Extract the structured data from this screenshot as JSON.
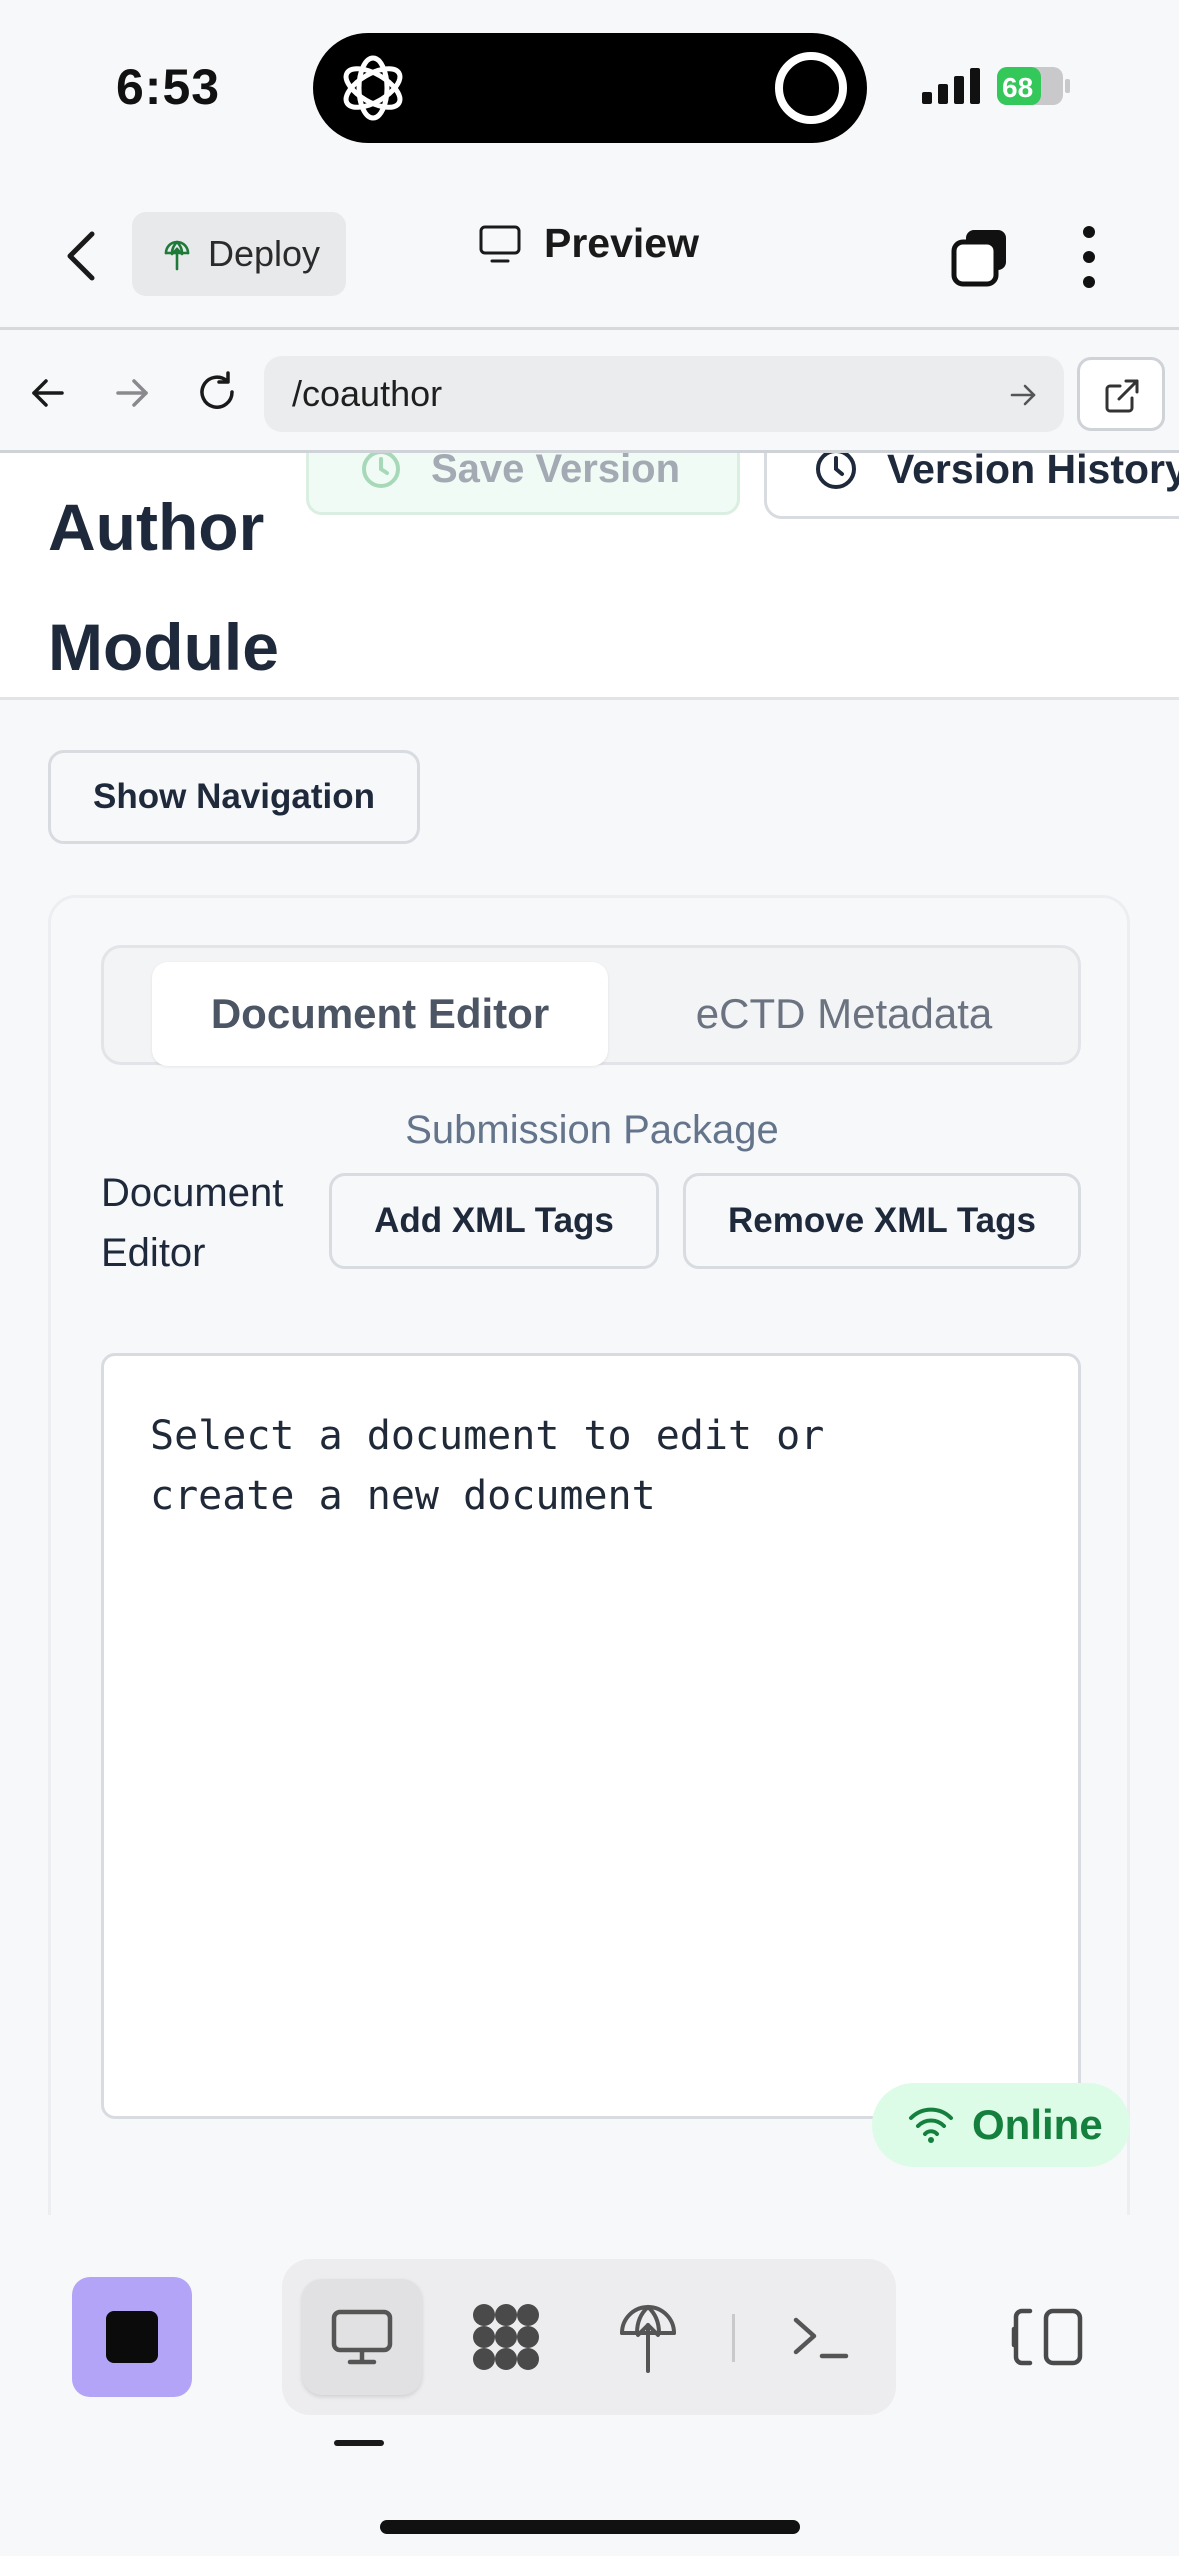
{
  "status_bar": {
    "time": "6:53",
    "battery": "68"
  },
  "app_bar": {
    "deploy_label": "Deploy",
    "preview_label": "Preview"
  },
  "browser": {
    "url": "/coauthor"
  },
  "page_header": {
    "title": "Author Module",
    "save_version_label": "Save Version",
    "version_history_label": "Version History"
  },
  "content": {
    "show_navigation_label": "Show Navigation",
    "tabs": [
      {
        "label": "Document Editor",
        "active": true
      },
      {
        "label": "eCTD Metadata",
        "active": false
      }
    ],
    "submission_package_label": "Submission Package",
    "editor_label": "Document Editor",
    "add_xml_label": "Add XML Tags",
    "remove_xml_label": "Remove XML Tags",
    "editor_placeholder": "Select a document to edit or create a new document"
  },
  "connection": {
    "status_label": "Online"
  },
  "colors": {
    "accent_purple": "#b3a4f7",
    "online_green": "#15803d",
    "online_bg": "#dcfce7",
    "heading": "#1e293b"
  },
  "bottom_toolbar": {
    "items": [
      "desktop-icon",
      "apps-grid-icon",
      "deploy-icon",
      "terminal-icon"
    ],
    "active_item": "desktop-icon"
  }
}
